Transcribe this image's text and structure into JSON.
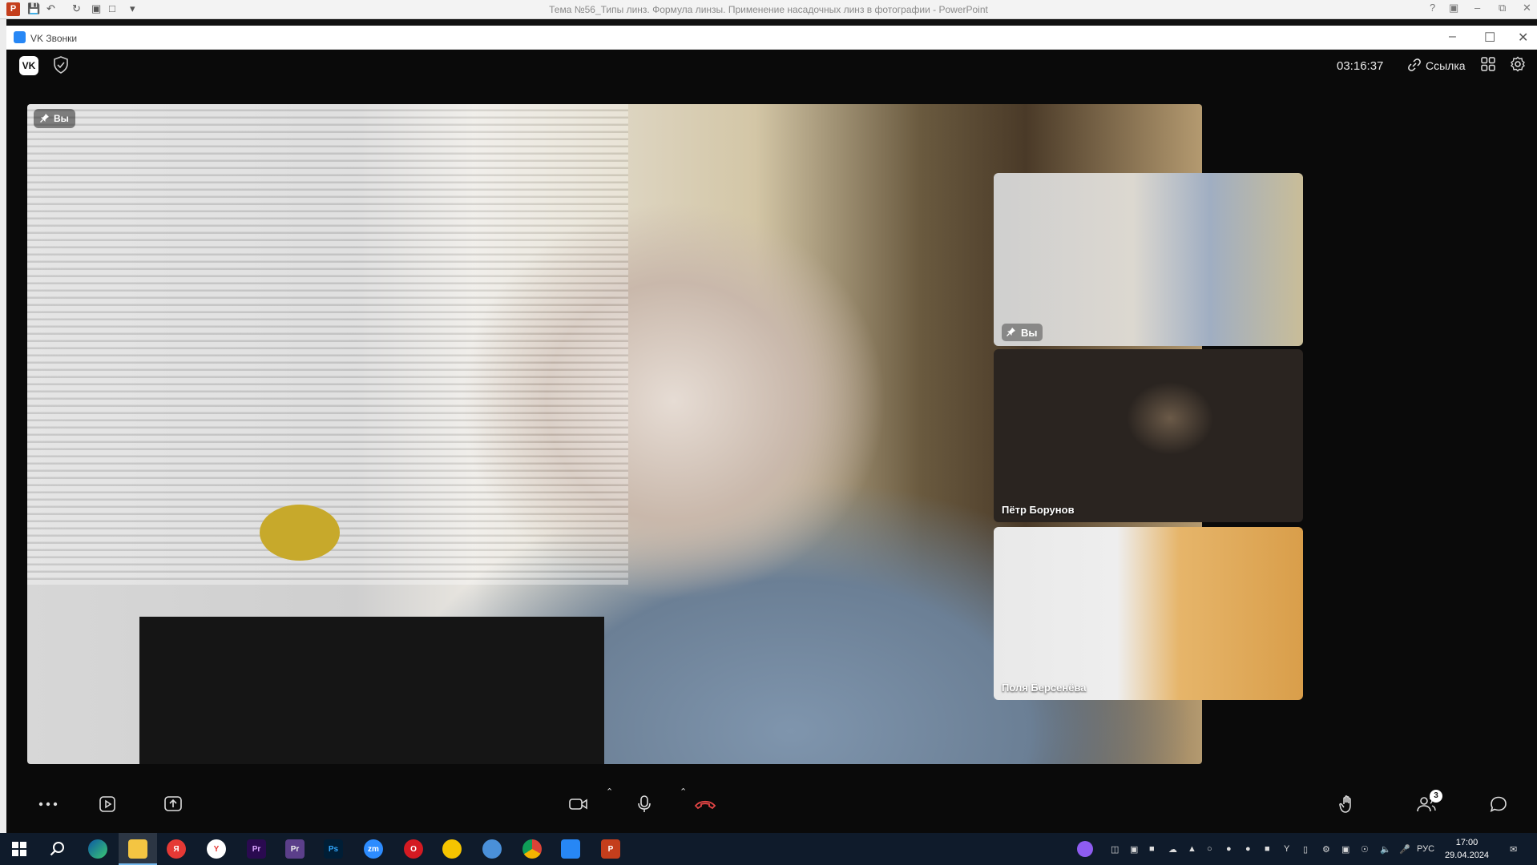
{
  "powerpoint": {
    "title": "Тема №56_Типы линз. Формула линзы. Применение насадочных линз в фотографии - PowerPoint",
    "logo_letter": "P"
  },
  "vk_window": {
    "title": "VK Звонки"
  },
  "topbar": {
    "logo_text": "VK",
    "timer": "03:16:37",
    "link_label": "Ссылка"
  },
  "main_video": {
    "badge_label": "Вы"
  },
  "participants": [
    {
      "name": "Вы",
      "pinned": true
    },
    {
      "name": "Пётр Борунов"
    },
    {
      "name": "Поля Берсенёва"
    }
  ],
  "controls": {
    "participants_count": "3"
  },
  "taskbar": {
    "apps": [
      {
        "icon": "start-icon"
      },
      {
        "icon": "search-icon"
      },
      {
        "icon": "edge-icon"
      },
      {
        "icon": "explorer-icon"
      },
      {
        "icon": "yandex-icon",
        "label": "Я"
      },
      {
        "icon": "yandex-browser-icon",
        "label": "Y"
      },
      {
        "icon": "premiere-icon",
        "label": "Pr"
      },
      {
        "icon": "premiere-elements-icon",
        "label": "Pr"
      },
      {
        "icon": "photoshop-icon",
        "label": "Ps"
      },
      {
        "icon": "zoom-icon",
        "label": "zm"
      },
      {
        "icon": "opera-icon",
        "label": "O"
      },
      {
        "icon": "norton-icon"
      },
      {
        "icon": "network-icon"
      },
      {
        "icon": "chrome-icon"
      },
      {
        "icon": "vk-calls-icon"
      },
      {
        "icon": "powerpoint-icon",
        "label": "P"
      }
    ],
    "language": "РУС",
    "time": "17:00",
    "date": "29.04.2024"
  },
  "colors": {
    "vk_blue": "#2787f5",
    "hangup_red": "#e64646",
    "ppt_red": "#c43e1c",
    "taskbar_bg": "#0f1b2b"
  }
}
